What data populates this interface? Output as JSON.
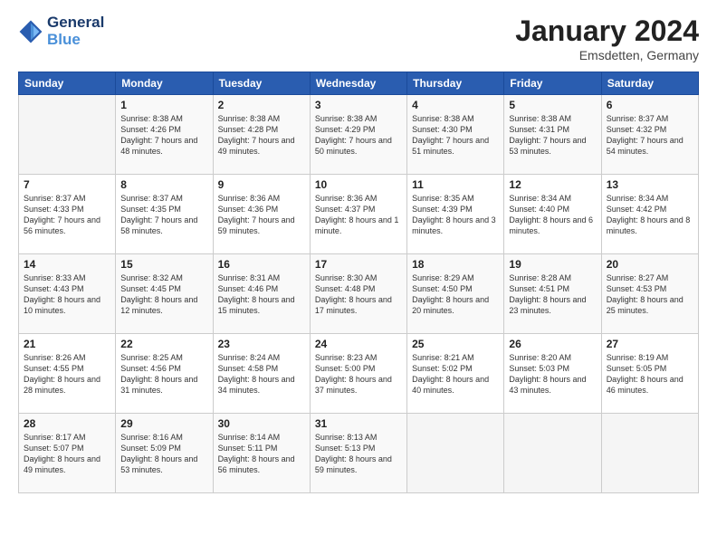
{
  "logo": {
    "line1": "General",
    "line2": "Blue"
  },
  "header": {
    "month": "January 2024",
    "location": "Emsdetten, Germany"
  },
  "weekdays": [
    "Sunday",
    "Monday",
    "Tuesday",
    "Wednesday",
    "Thursday",
    "Friday",
    "Saturday"
  ],
  "weeks": [
    [
      {
        "day": "",
        "sunrise": "",
        "sunset": "",
        "daylight": ""
      },
      {
        "day": "1",
        "sunrise": "Sunrise: 8:38 AM",
        "sunset": "Sunset: 4:26 PM",
        "daylight": "Daylight: 7 hours and 48 minutes."
      },
      {
        "day": "2",
        "sunrise": "Sunrise: 8:38 AM",
        "sunset": "Sunset: 4:28 PM",
        "daylight": "Daylight: 7 hours and 49 minutes."
      },
      {
        "day": "3",
        "sunrise": "Sunrise: 8:38 AM",
        "sunset": "Sunset: 4:29 PM",
        "daylight": "Daylight: 7 hours and 50 minutes."
      },
      {
        "day": "4",
        "sunrise": "Sunrise: 8:38 AM",
        "sunset": "Sunset: 4:30 PM",
        "daylight": "Daylight: 7 hours and 51 minutes."
      },
      {
        "day": "5",
        "sunrise": "Sunrise: 8:38 AM",
        "sunset": "Sunset: 4:31 PM",
        "daylight": "Daylight: 7 hours and 53 minutes."
      },
      {
        "day": "6",
        "sunrise": "Sunrise: 8:37 AM",
        "sunset": "Sunset: 4:32 PM",
        "daylight": "Daylight: 7 hours and 54 minutes."
      }
    ],
    [
      {
        "day": "7",
        "sunrise": "Sunrise: 8:37 AM",
        "sunset": "Sunset: 4:33 PM",
        "daylight": "Daylight: 7 hours and 56 minutes."
      },
      {
        "day": "8",
        "sunrise": "Sunrise: 8:37 AM",
        "sunset": "Sunset: 4:35 PM",
        "daylight": "Daylight: 7 hours and 58 minutes."
      },
      {
        "day": "9",
        "sunrise": "Sunrise: 8:36 AM",
        "sunset": "Sunset: 4:36 PM",
        "daylight": "Daylight: 7 hours and 59 minutes."
      },
      {
        "day": "10",
        "sunrise": "Sunrise: 8:36 AM",
        "sunset": "Sunset: 4:37 PM",
        "daylight": "Daylight: 8 hours and 1 minute."
      },
      {
        "day": "11",
        "sunrise": "Sunrise: 8:35 AM",
        "sunset": "Sunset: 4:39 PM",
        "daylight": "Daylight: 8 hours and 3 minutes."
      },
      {
        "day": "12",
        "sunrise": "Sunrise: 8:34 AM",
        "sunset": "Sunset: 4:40 PM",
        "daylight": "Daylight: 8 hours and 6 minutes."
      },
      {
        "day": "13",
        "sunrise": "Sunrise: 8:34 AM",
        "sunset": "Sunset: 4:42 PM",
        "daylight": "Daylight: 8 hours and 8 minutes."
      }
    ],
    [
      {
        "day": "14",
        "sunrise": "Sunrise: 8:33 AM",
        "sunset": "Sunset: 4:43 PM",
        "daylight": "Daylight: 8 hours and 10 minutes."
      },
      {
        "day": "15",
        "sunrise": "Sunrise: 8:32 AM",
        "sunset": "Sunset: 4:45 PM",
        "daylight": "Daylight: 8 hours and 12 minutes."
      },
      {
        "day": "16",
        "sunrise": "Sunrise: 8:31 AM",
        "sunset": "Sunset: 4:46 PM",
        "daylight": "Daylight: 8 hours and 15 minutes."
      },
      {
        "day": "17",
        "sunrise": "Sunrise: 8:30 AM",
        "sunset": "Sunset: 4:48 PM",
        "daylight": "Daylight: 8 hours and 17 minutes."
      },
      {
        "day": "18",
        "sunrise": "Sunrise: 8:29 AM",
        "sunset": "Sunset: 4:50 PM",
        "daylight": "Daylight: 8 hours and 20 minutes."
      },
      {
        "day": "19",
        "sunrise": "Sunrise: 8:28 AM",
        "sunset": "Sunset: 4:51 PM",
        "daylight": "Daylight: 8 hours and 23 minutes."
      },
      {
        "day": "20",
        "sunrise": "Sunrise: 8:27 AM",
        "sunset": "Sunset: 4:53 PM",
        "daylight": "Daylight: 8 hours and 25 minutes."
      }
    ],
    [
      {
        "day": "21",
        "sunrise": "Sunrise: 8:26 AM",
        "sunset": "Sunset: 4:55 PM",
        "daylight": "Daylight: 8 hours and 28 minutes."
      },
      {
        "day": "22",
        "sunrise": "Sunrise: 8:25 AM",
        "sunset": "Sunset: 4:56 PM",
        "daylight": "Daylight: 8 hours and 31 minutes."
      },
      {
        "day": "23",
        "sunrise": "Sunrise: 8:24 AM",
        "sunset": "Sunset: 4:58 PM",
        "daylight": "Daylight: 8 hours and 34 minutes."
      },
      {
        "day": "24",
        "sunrise": "Sunrise: 8:23 AM",
        "sunset": "Sunset: 5:00 PM",
        "daylight": "Daylight: 8 hours and 37 minutes."
      },
      {
        "day": "25",
        "sunrise": "Sunrise: 8:21 AM",
        "sunset": "Sunset: 5:02 PM",
        "daylight": "Daylight: 8 hours and 40 minutes."
      },
      {
        "day": "26",
        "sunrise": "Sunrise: 8:20 AM",
        "sunset": "Sunset: 5:03 PM",
        "daylight": "Daylight: 8 hours and 43 minutes."
      },
      {
        "day": "27",
        "sunrise": "Sunrise: 8:19 AM",
        "sunset": "Sunset: 5:05 PM",
        "daylight": "Daylight: 8 hours and 46 minutes."
      }
    ],
    [
      {
        "day": "28",
        "sunrise": "Sunrise: 8:17 AM",
        "sunset": "Sunset: 5:07 PM",
        "daylight": "Daylight: 8 hours and 49 minutes."
      },
      {
        "day": "29",
        "sunrise": "Sunrise: 8:16 AM",
        "sunset": "Sunset: 5:09 PM",
        "daylight": "Daylight: 8 hours and 53 minutes."
      },
      {
        "day": "30",
        "sunrise": "Sunrise: 8:14 AM",
        "sunset": "Sunset: 5:11 PM",
        "daylight": "Daylight: 8 hours and 56 minutes."
      },
      {
        "day": "31",
        "sunrise": "Sunrise: 8:13 AM",
        "sunset": "Sunset: 5:13 PM",
        "daylight": "Daylight: 8 hours and 59 minutes."
      },
      {
        "day": "",
        "sunrise": "",
        "sunset": "",
        "daylight": ""
      },
      {
        "day": "",
        "sunrise": "",
        "sunset": "",
        "daylight": ""
      },
      {
        "day": "",
        "sunrise": "",
        "sunset": "",
        "daylight": ""
      }
    ]
  ]
}
